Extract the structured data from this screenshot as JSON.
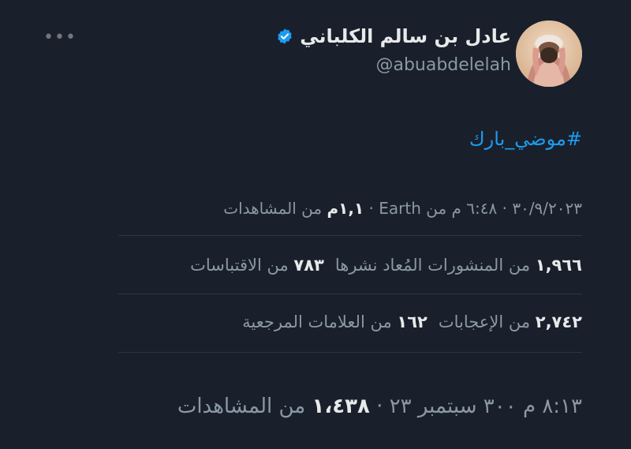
{
  "tweet": {
    "author_name": "عادل بن سالم الكلباني",
    "handle": "@abuabdelelah",
    "more_label": "•••",
    "hashtag": "#موضي_بارك"
  },
  "meta": {
    "date_time": "٣٠/٩/٢٠٢٣ · ٦:٤٨ م من Earth · ",
    "views_count": "١,١م",
    "views_label": " من المشاهدات"
  },
  "stats": {
    "reposts_count": "١,٩٦٦",
    "reposts_label": " من المنشورات المُعاد نشرها",
    "quotes_count": "٧٨٣",
    "quotes_label": " من الاقتباسات",
    "likes_count": "٢,٧٤٢",
    "likes_label": " من الإعجابات",
    "bookmarks_count": "١٦٢",
    "bookmarks_label": " من العلامات المرجعية"
  },
  "bottom": {
    "text": "٨:١٣ م ٣٠٠ سبتمبر ٢٣ · ",
    "views_count": "١،٤٣٨",
    "views_label": " من المشاهدات"
  },
  "colors": {
    "background": "#19202b",
    "accent": "#1d9bf0",
    "secondary_text": "#8b98a5",
    "primary_text": "#e7e9ea"
  },
  "icons": {
    "verified": "verified-badge-icon",
    "more": "more-options-icon"
  }
}
